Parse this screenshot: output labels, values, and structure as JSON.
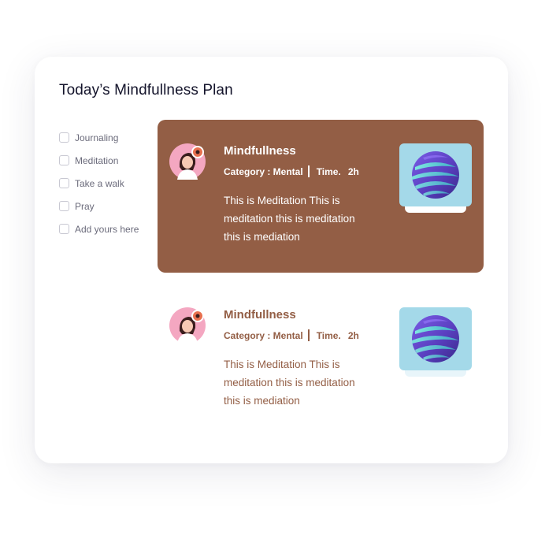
{
  "plan": {
    "title": "Today’s Mindfullness Plan"
  },
  "checklist": [
    {
      "label": "Journaling",
      "checked": false
    },
    {
      "label": "Meditation",
      "checked": false
    },
    {
      "label": "Take a walk",
      "checked": false
    },
    {
      "label": "Pray",
      "checked": false
    },
    {
      "label": "Add yours here",
      "checked": false
    }
  ],
  "cards": [
    {
      "title": "Mindfullness",
      "category": "Category : Mental",
      "time_label": "Time.",
      "time_value": "2h",
      "description": "This is Meditation This is meditation this is meditation this is mediation",
      "active": true
    },
    {
      "title": "Mindfullness",
      "category": "Category : Mental",
      "time_label": "Time.",
      "time_value": "2h",
      "description": "This is Meditation This is meditation this is meditation this is mediation",
      "active": false
    }
  ],
  "colors": {
    "accent": "#935e45",
    "thumbnail_bg": "#a4d9e9",
    "avatar_bg": "#f4a7c1",
    "title_text": "#14142b",
    "muted_text": "#6b6b7b"
  },
  "icons": {
    "avatar": "meditating-person-avatar",
    "thumbnail": "3d-spiral-sphere-image"
  }
}
